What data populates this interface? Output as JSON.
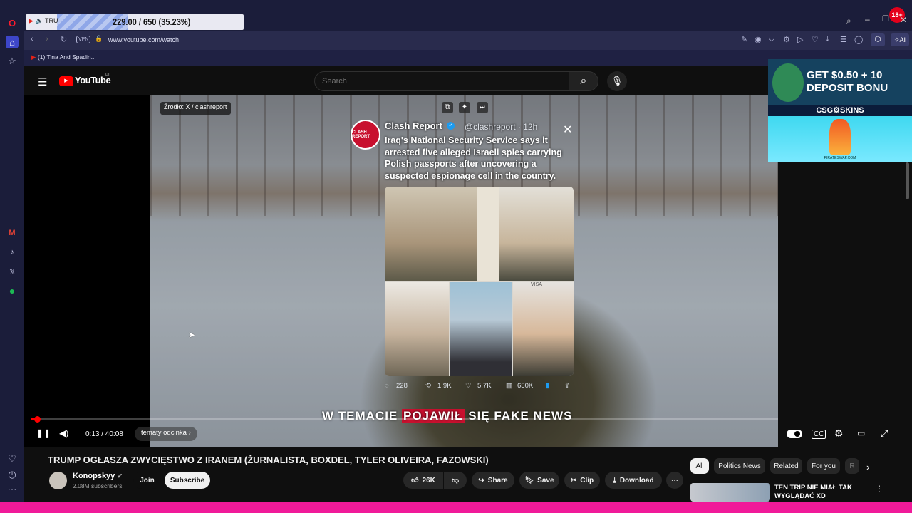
{
  "browser": {
    "tab_label": "TRU",
    "tab_progress": "229.00 / 650 (35.23%)",
    "badge": "18+",
    "url": "www.youtube.com/watch",
    "vpn": "VPN",
    "bookmark": "(1) Tina And Spadin...",
    "ai_label": "AI"
  },
  "youtube": {
    "logo": "YouTube",
    "region": "PL",
    "search_placeholder": "Search"
  },
  "video": {
    "source_label": "Źródło: X / clashreport",
    "tweet": {
      "avatar_text": "CLASH REPORT",
      "name": "Clash Report",
      "handle": "@clashreport · 12h",
      "text": "Iraq's National Security Service says it arrested five alleged Israeli spies carrying Polish passports after uncovering a suspected espionage cell in the country.",
      "passport_label": "VISA",
      "replies": "228",
      "reposts": "1,9K",
      "likes": "5,7K",
      "views": "650K"
    },
    "caption_before": "W TEMACIE ",
    "caption_highlight": "POJAWIŁ",
    "caption_after": " SIĘ FAKE NEWS",
    "time": "0:13 / 40:08",
    "chapter": "tematy odcinka",
    "progress": 0.0054
  },
  "details": {
    "title": "TRUMP OGŁASZA ZWYCIĘSTWO Z IRANEM (ŻURNALISTA, BOXDEL, TYLER OLIVEIRA, FAZOWSKI)",
    "channel": "Konopskyy",
    "subscribers": "2.08M subscribers",
    "join": "Join",
    "subscribe": "Subscribe",
    "likes": "26K",
    "share": "Share",
    "save": "Save",
    "clip": "Clip",
    "download": "Download"
  },
  "chips": [
    "All",
    "Politics News",
    "Related",
    "For you",
    "R"
  ],
  "related": {
    "title": "TEN TRIP NIE MIAŁ TAK WYGLĄDAĆ XD"
  },
  "ad": {
    "headline_1": "GET $0.50 + 10",
    "headline_2": "DEPOSIT BONU",
    "brand": "CSG⚙SKINS",
    "footer": "PIRATESWAP.COM"
  },
  "colors": {
    "accent_red": "#ff0000",
    "opera_bg": "#1b1d3a",
    "pink_bar": "#f01a99"
  }
}
